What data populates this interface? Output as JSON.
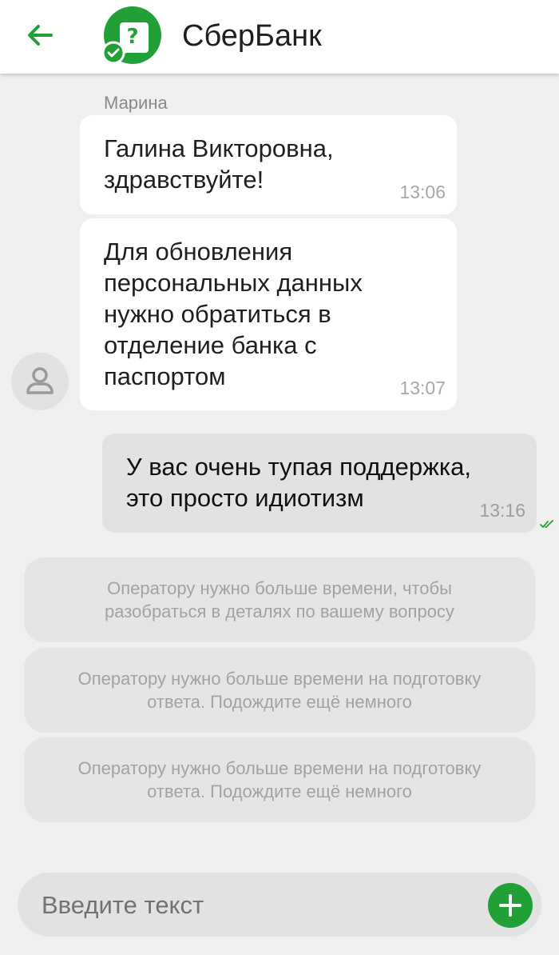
{
  "header": {
    "title": "СберБанк",
    "back_icon": "arrow-left-icon",
    "logo_icon": "sber-support-logo-icon"
  },
  "colors": {
    "accent": "#21a038",
    "background": "#efefef",
    "incoming_bubble": "#ffffff",
    "outgoing_bubble": "#e2e2e2",
    "system_note": "#e5e5e5"
  },
  "chat": {
    "sender_name": "Марина",
    "messages": [
      {
        "direction": "incoming",
        "text": "Галина Викторовна,\nздравствуйте!",
        "time": "13:06"
      },
      {
        "direction": "incoming",
        "text": "Для обновления\nперсональных данных\nнужно обратиться в\nотделение банка с\nпаспортом",
        "time": "13:07"
      },
      {
        "direction": "outgoing",
        "text": "У вас очень тупая поддержка,\nэто просто идиотизм",
        "time": "13:16",
        "status_icon": "double-check-icon"
      }
    ],
    "system_notes": [
      "Оператору нужно больше времени, чтобы\nразобраться в деталях по вашему вопросу",
      "Оператору нужно больше времени на подготовку\nответа. Подождите ещё немного",
      "Оператору нужно больше времени на подготовку\nответа. Подождите ещё немного"
    ]
  },
  "composer": {
    "placeholder": "Введите текст",
    "value": "",
    "add_icon": "plus-icon"
  }
}
